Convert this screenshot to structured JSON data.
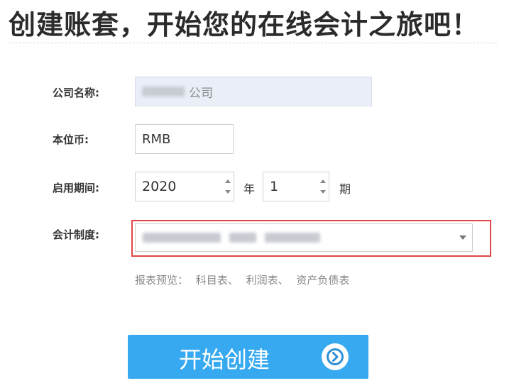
{
  "page": {
    "title": "创建账套，开始您的在线会计之旅吧！"
  },
  "form": {
    "company": {
      "label": "公司名称:",
      "value_suffix": "公司"
    },
    "currency": {
      "label": "本位币:",
      "value": "RMB"
    },
    "period": {
      "label": "启用期间:",
      "year": "2020",
      "year_unit": "年",
      "period": "1",
      "period_unit": "期"
    },
    "accounting_system": {
      "label": "会计制度:"
    },
    "preview": {
      "label": "报表预览：",
      "items": [
        "科目表、",
        "利润表、",
        "资产负债表"
      ]
    }
  },
  "actions": {
    "start_label": "开始创建"
  },
  "colors": {
    "primary": "#36a9f0",
    "highlight_border": "#e04848",
    "disabled_input_bg": "#e9eef7"
  },
  "icons": {
    "start_button_icon": "chevron-right-circle-icon",
    "select_icon": "caret-down-icon",
    "spinner_up": "arrow-up-icon",
    "spinner_down": "arrow-down-icon"
  }
}
